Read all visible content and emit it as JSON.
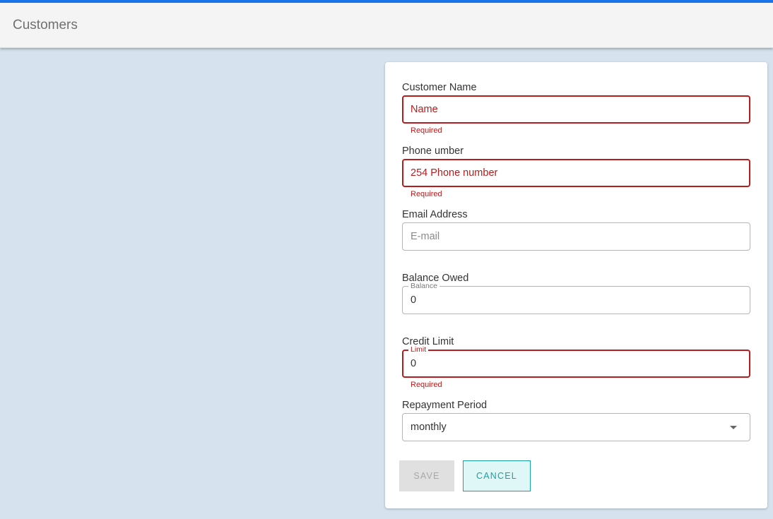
{
  "app": {
    "title": "Customers"
  },
  "form": {
    "customer_name": {
      "label": "Customer Name",
      "placeholder": "Name",
      "value": "",
      "helper": "Required"
    },
    "phone_number": {
      "label": "Phone umber",
      "placeholder": "254 Phone number",
      "value": "",
      "helper": "Required"
    },
    "email": {
      "label": "Email Address",
      "placeholder": "E-mail",
      "value": ""
    },
    "balance_owed": {
      "label": "Balance Owed",
      "legend": "Balance",
      "value": "0"
    },
    "credit_limit": {
      "label": "Credit Limit",
      "legend": "Limit",
      "value": "0",
      "helper": "Required"
    },
    "repayment_period": {
      "label": "Repayment Period",
      "selected": "monthly"
    },
    "buttons": {
      "save": "SAVE",
      "cancel": "CANCEL"
    }
  },
  "colors": {
    "accent": "#1a73e8",
    "error": "#b71c1c",
    "teal": "#17a3a3",
    "background": "#d6e3ef"
  }
}
